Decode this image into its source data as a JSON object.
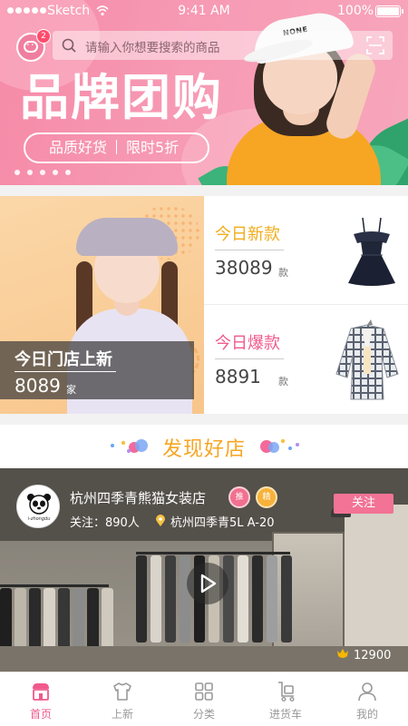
{
  "status_bar": {
    "carrier": "Sketch",
    "time": "9:41 AM",
    "battery": "100%"
  },
  "header": {
    "message_badge": "2",
    "search_placeholder": "请输入你想要搜索的商品"
  },
  "banner": {
    "title": "品牌团购",
    "cap_text": "NONE",
    "tag_quality": "品质好货",
    "tag_discount": "限时5折",
    "slide_count": 5
  },
  "promo": {
    "store_new": {
      "label": "今日门店上新",
      "count": "8089",
      "unit": "家"
    },
    "today_new": {
      "label": "今日新款",
      "count": "38089",
      "unit": "款"
    },
    "today_hot": {
      "label": "今日爆款",
      "count": "8891",
      "unit": "款"
    }
  },
  "section": {
    "title": "发现好店"
  },
  "store": {
    "name": "杭州四季青熊猫女装店",
    "avatar_text": "i-zhongdu",
    "badge1": "推",
    "badge2": "精",
    "followers": "关注：890人",
    "address": "杭州四季青5L A-20",
    "follow_label": "关注",
    "likes": "12900"
  },
  "tabbar": [
    {
      "label": "首页",
      "icon": "home-icon",
      "active": true
    },
    {
      "label": "上新",
      "icon": "tshirt-icon",
      "active": false
    },
    {
      "label": "分类",
      "icon": "grid-icon",
      "active": false
    },
    {
      "label": "进货车",
      "icon": "cart-icon",
      "active": false
    },
    {
      "label": "我的",
      "icon": "user-icon",
      "active": false
    }
  ],
  "colors": {
    "accent_pink": "#f05a8c",
    "accent_gold": "#f5a623",
    "banner_pink": "#f79ab4"
  }
}
